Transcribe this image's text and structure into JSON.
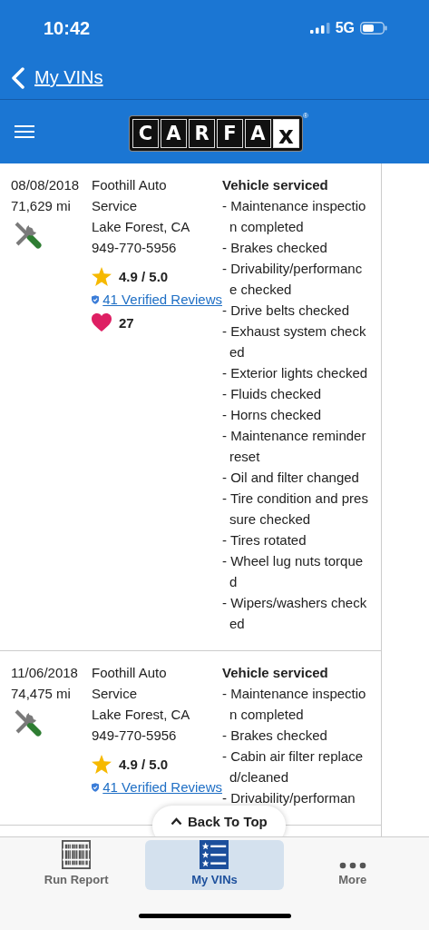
{
  "status_bar": {
    "time": "10:42",
    "network": "5G"
  },
  "nav": {
    "back_label": "My VINs"
  },
  "header": {
    "logo_letters": [
      "C",
      "A",
      "R",
      "F",
      "A",
      "x"
    ],
    "logo_mark": "®"
  },
  "records": [
    {
      "date": "08/08/2018",
      "mileage": "71,629 mi",
      "shop": [
        "Foothill Auto",
        "Service",
        "Lake Forest, CA",
        "949-770-5956"
      ],
      "rating": "4.9 / 5.0",
      "reviews": "41 Verified Reviews",
      "likes": "27",
      "heading": "Vehicle serviced",
      "items": [
        "- Maintenance inspection completed",
        "- Brakes checked",
        "- Drivability/performance checked",
        "- Drive belts checked",
        "- Exhaust system checked",
        "- Exterior lights checked",
        "- Fluids checked",
        "- Horns checked",
        "- Maintenance reminder reset",
        "- Oil and filter changed",
        "- Tire condition and pressure checked",
        "- Tires rotated",
        "- Wheel lug nuts torqued",
        "- Wipers/washers checked"
      ]
    },
    {
      "date": "11/06/2018",
      "mileage": "74,475 mi",
      "shop": [
        "Foothill Auto",
        "Service",
        "Lake Forest, CA",
        "949-770-5956"
      ],
      "rating": "4.9 / 5.0",
      "reviews": "41 Verified Reviews",
      "heading": "Vehicle serviced",
      "items": [
        "- Maintenance inspection completed",
        "- Brakes checked",
        "- Cabin air filter replaced/cleaned",
        "- Drivability/performan"
      ]
    }
  ],
  "back_to_top": "Back To Top",
  "tabs": [
    {
      "label": "Run Report",
      "kind": "barcode",
      "selected": false
    },
    {
      "label": "My VINs",
      "kind": "list",
      "selected": true
    },
    {
      "label": "More",
      "kind": "more",
      "selected": false
    }
  ]
}
